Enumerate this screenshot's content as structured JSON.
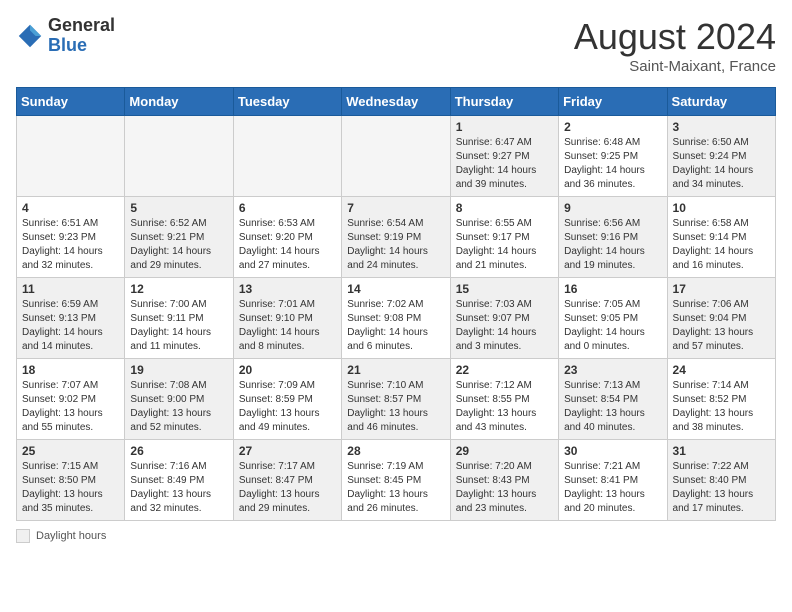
{
  "header": {
    "logo_general": "General",
    "logo_blue": "Blue",
    "month_title": "August 2024",
    "subtitle": "Saint-Maixant, France"
  },
  "days_of_week": [
    "Sunday",
    "Monday",
    "Tuesday",
    "Wednesday",
    "Thursday",
    "Friday",
    "Saturday"
  ],
  "weeks": [
    [
      {
        "day": "",
        "empty": true
      },
      {
        "day": "",
        "empty": true
      },
      {
        "day": "",
        "empty": true
      },
      {
        "day": "",
        "empty": true
      },
      {
        "day": "1",
        "sunrise": "6:47 AM",
        "sunset": "9:27 PM",
        "daylight": "14 hours and 39 minutes."
      },
      {
        "day": "2",
        "sunrise": "6:48 AM",
        "sunset": "9:25 PM",
        "daylight": "14 hours and 36 minutes."
      },
      {
        "day": "3",
        "sunrise": "6:50 AM",
        "sunset": "9:24 PM",
        "daylight": "14 hours and 34 minutes."
      }
    ],
    [
      {
        "day": "4",
        "sunrise": "6:51 AM",
        "sunset": "9:23 PM",
        "daylight": "14 hours and 32 minutes."
      },
      {
        "day": "5",
        "sunrise": "6:52 AM",
        "sunset": "9:21 PM",
        "daylight": "14 hours and 29 minutes."
      },
      {
        "day": "6",
        "sunrise": "6:53 AM",
        "sunset": "9:20 PM",
        "daylight": "14 hours and 27 minutes."
      },
      {
        "day": "7",
        "sunrise": "6:54 AM",
        "sunset": "9:19 PM",
        "daylight": "14 hours and 24 minutes."
      },
      {
        "day": "8",
        "sunrise": "6:55 AM",
        "sunset": "9:17 PM",
        "daylight": "14 hours and 21 minutes."
      },
      {
        "day": "9",
        "sunrise": "6:56 AM",
        "sunset": "9:16 PM",
        "daylight": "14 hours and 19 minutes."
      },
      {
        "day": "10",
        "sunrise": "6:58 AM",
        "sunset": "9:14 PM",
        "daylight": "14 hours and 16 minutes."
      }
    ],
    [
      {
        "day": "11",
        "sunrise": "6:59 AM",
        "sunset": "9:13 PM",
        "daylight": "14 hours and 14 minutes."
      },
      {
        "day": "12",
        "sunrise": "7:00 AM",
        "sunset": "9:11 PM",
        "daylight": "14 hours and 11 minutes."
      },
      {
        "day": "13",
        "sunrise": "7:01 AM",
        "sunset": "9:10 PM",
        "daylight": "14 hours and 8 minutes."
      },
      {
        "day": "14",
        "sunrise": "7:02 AM",
        "sunset": "9:08 PM",
        "daylight": "14 hours and 6 minutes."
      },
      {
        "day": "15",
        "sunrise": "7:03 AM",
        "sunset": "9:07 PM",
        "daylight": "14 hours and 3 minutes."
      },
      {
        "day": "16",
        "sunrise": "7:05 AM",
        "sunset": "9:05 PM",
        "daylight": "14 hours and 0 minutes."
      },
      {
        "day": "17",
        "sunrise": "7:06 AM",
        "sunset": "9:04 PM",
        "daylight": "13 hours and 57 minutes."
      }
    ],
    [
      {
        "day": "18",
        "sunrise": "7:07 AM",
        "sunset": "9:02 PM",
        "daylight": "13 hours and 55 minutes."
      },
      {
        "day": "19",
        "sunrise": "7:08 AM",
        "sunset": "9:00 PM",
        "daylight": "13 hours and 52 minutes."
      },
      {
        "day": "20",
        "sunrise": "7:09 AM",
        "sunset": "8:59 PM",
        "daylight": "13 hours and 49 minutes."
      },
      {
        "day": "21",
        "sunrise": "7:10 AM",
        "sunset": "8:57 PM",
        "daylight": "13 hours and 46 minutes."
      },
      {
        "day": "22",
        "sunrise": "7:12 AM",
        "sunset": "8:55 PM",
        "daylight": "13 hours and 43 minutes."
      },
      {
        "day": "23",
        "sunrise": "7:13 AM",
        "sunset": "8:54 PM",
        "daylight": "13 hours and 40 minutes."
      },
      {
        "day": "24",
        "sunrise": "7:14 AM",
        "sunset": "8:52 PM",
        "daylight": "13 hours and 38 minutes."
      }
    ],
    [
      {
        "day": "25",
        "sunrise": "7:15 AM",
        "sunset": "8:50 PM",
        "daylight": "13 hours and 35 minutes."
      },
      {
        "day": "26",
        "sunrise": "7:16 AM",
        "sunset": "8:49 PM",
        "daylight": "13 hours and 32 minutes."
      },
      {
        "day": "27",
        "sunrise": "7:17 AM",
        "sunset": "8:47 PM",
        "daylight": "13 hours and 29 minutes."
      },
      {
        "day": "28",
        "sunrise": "7:19 AM",
        "sunset": "8:45 PM",
        "daylight": "13 hours and 26 minutes."
      },
      {
        "day": "29",
        "sunrise": "7:20 AM",
        "sunset": "8:43 PM",
        "daylight": "13 hours and 23 minutes."
      },
      {
        "day": "30",
        "sunrise": "7:21 AM",
        "sunset": "8:41 PM",
        "daylight": "13 hours and 20 minutes."
      },
      {
        "day": "31",
        "sunrise": "7:22 AM",
        "sunset": "8:40 PM",
        "daylight": "13 hours and 17 minutes."
      }
    ]
  ],
  "footer": {
    "daylight_label": "Daylight hours"
  },
  "colors": {
    "header_bg": "#2a6db5",
    "shaded_bg": "#f0f0f0"
  }
}
